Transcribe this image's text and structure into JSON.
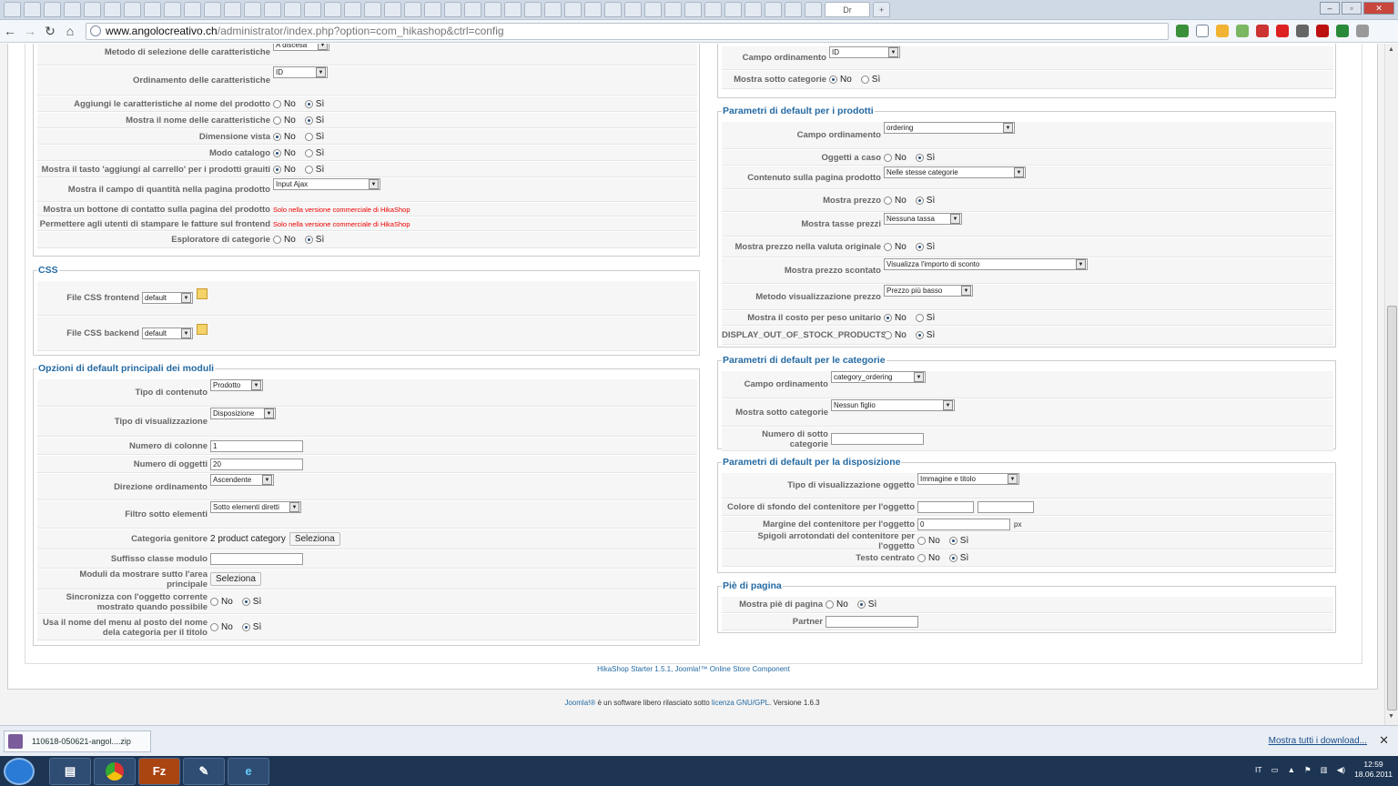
{
  "browser": {
    "url_host": "www.angolocreativo.ch",
    "url_path": "/administrator/index.php?option=com_hikashop&ctrl=config",
    "active_tab_label": "Dr",
    "tab_icons": [
      "Chrome",
      "Chrome",
      "Chrome",
      "Agent",
      "Tag",
      "Sheet",
      "Blogger",
      "Notes",
      "Gmail",
      "Black",
      "Chrome",
      "RSS",
      "Pirate",
      "Android",
      "Chrome",
      "Chrome",
      "Album",
      "Puzzle",
      "Book",
      "Star",
      "Star",
      "Mail",
      "Chrome",
      "Flickr",
      "Flickr",
      "Delicious",
      "Hand",
      "Help",
      "Wheel",
      "Wheel",
      "Wheel",
      "Wheel",
      "Firefox",
      "PSE",
      "Word",
      "Gray",
      "Gray",
      "Chrome",
      "FB",
      "Check",
      "GT",
      "Dr"
    ]
  },
  "left": {
    "rows_top": [
      {
        "label": "Metodo di selezione delle caratteristiche",
        "select": "A discesa"
      },
      {
        "label": "Ordinamento delle caratteristiche",
        "select": "ID"
      },
      {
        "label": "Aggiungi le caratteristiche al nome del prodotto",
        "radio": "Sì"
      },
      {
        "label": "Mostra il nome delle caratteristiche",
        "radio": "Sì"
      },
      {
        "label": "Dimensione vista",
        "radio": "No"
      },
      {
        "label": "Modo catalogo",
        "radio": "No"
      },
      {
        "label": "Mostra il tasto 'aggiungi al carrello' per i prodotti grauiti",
        "radio": "No"
      },
      {
        "label": "Mostra il campo di quantità nella pagina prodotto",
        "select": "Input Ajax"
      },
      {
        "label": "Mostra un bottone di contatto sulla pagina del prodotto",
        "note": "Solo nella versione commerciale di HikaShop"
      },
      {
        "label": "Permettere agli utenti di stampare le fatture sul frontend",
        "note": "Solo nella versione commerciale di HikaShop"
      },
      {
        "label": "Esploratore di categorie",
        "radio": "Sì"
      }
    ],
    "css": {
      "legend": "CSS",
      "rows": [
        {
          "label": "File CSS frontend",
          "select": "default"
        },
        {
          "label": "File CSS backend",
          "select": "default"
        }
      ]
    },
    "modules": {
      "legend": "Opzioni di default principali dei moduli",
      "rows": [
        {
          "label": "Tipo di contenuto",
          "select": "Prodotto"
        },
        {
          "label": "Tipo di visualizzazione",
          "select": "Disposizione"
        },
        {
          "label": "Numero di colonne",
          "input": "1"
        },
        {
          "label": "Numero di oggetti",
          "input": "20"
        },
        {
          "label": "Direzione ordinamento",
          "select": "Ascendente"
        },
        {
          "label": "Filtro sotto elementi",
          "select": "Sotto elementi diretti"
        },
        {
          "label": "Categoria genitore",
          "text": "2 product category",
          "button": "Seleziona"
        },
        {
          "label": "Suffisso classe modulo",
          "input": ""
        },
        {
          "label": "Moduli da mostrare sutto l'area principale",
          "button": "Seleziona"
        },
        {
          "label": "Sincronizza con l'oggetto corrente mostrato quando possibile",
          "radio": "Sì"
        },
        {
          "label": "Usa il nome del menu al posto del nome dela categoria per il titolo",
          "radio": "Sì"
        }
      ]
    }
  },
  "right": {
    "cat_top": [
      {
        "label": "Campo ordinamento",
        "select": "ID"
      },
      {
        "label": "Mostra sotto categorie",
        "radio": "No"
      }
    ],
    "products": {
      "legend": "Parametri di default per i prodotti",
      "rows": [
        {
          "label": "Campo ordinamento",
          "select": "ordering"
        },
        {
          "label": "Oggetti a caso",
          "radio": "Sì"
        },
        {
          "label": "Contenuto sulla pagina prodotto",
          "select": "Nelle stesse categorie"
        },
        {
          "label": "Mostra prezzo",
          "radio": "Sì"
        },
        {
          "label": "Mostra tasse prezzi",
          "select": "Nessuna tassa"
        },
        {
          "label": "Mostra prezzo nella valuta originale",
          "radio": "Sì"
        },
        {
          "label": "Mostra prezzo scontato",
          "select": "Visualizza l'importo di sconto"
        },
        {
          "label": "Metodo visualizzazione prezzo",
          "select": "Prezzo più basso"
        },
        {
          "label": "Mostra il costo per peso unitario",
          "radio": "No"
        },
        {
          "label": "DISPLAY_OUT_OF_STOCK_PRODUCTS",
          "radio": "Sì"
        }
      ]
    },
    "categories": {
      "legend": "Parametri di default per le categorie",
      "rows": [
        {
          "label": "Campo ordinamento",
          "select": "category_ordering"
        },
        {
          "label": "Mostra sotto categorie",
          "select": "Nessun figlio"
        },
        {
          "label": "Numero di sotto categorie",
          "input": ""
        }
      ]
    },
    "layout": {
      "legend": "Parametri di default per la disposizione",
      "rows": [
        {
          "label": "Tipo di visualizzazione oggetto",
          "select": "Immagine e titolo"
        },
        {
          "label": "Colore di sfondo del contenitore per l'oggetto",
          "input": ""
        },
        {
          "label": "Margine del contenitore per l'oggetto",
          "input": "0",
          "unit": "px"
        },
        {
          "label": "Spigoli arrotondati del contenitore per l'oggetto",
          "radio": "Sì"
        },
        {
          "label": "Testo centrato",
          "radio": "Sì"
        }
      ]
    },
    "footer": {
      "legend": "Piè di pagina",
      "rows": [
        {
          "label": "Mostra piè di pagina",
          "radio": "Sì"
        },
        {
          "label": "Partner",
          "input": ""
        }
      ]
    }
  },
  "radio_labels": {
    "no": "No",
    "yes": "Sì"
  },
  "footer_text": "HikaShop Starter 1.5.1, Joomla!™ Online Store Component",
  "joomla_footer": {
    "prefix": "Joomla!®",
    "middle": " è un software libero rilasciato sotto ",
    "license": "licenza GNU/GPL",
    "version": ".    Versione 1.6.3"
  },
  "download": {
    "file": "110618-050621-angol....zip",
    "show_all": "Mostra tutti i download...",
    "close": "✕"
  },
  "taskbar": {
    "apps": [
      "Explorer",
      "Chrome",
      "FileZilla",
      "Notepad",
      "IE"
    ],
    "lang": "IT",
    "time": "12:59",
    "date": "18.06.2011"
  }
}
